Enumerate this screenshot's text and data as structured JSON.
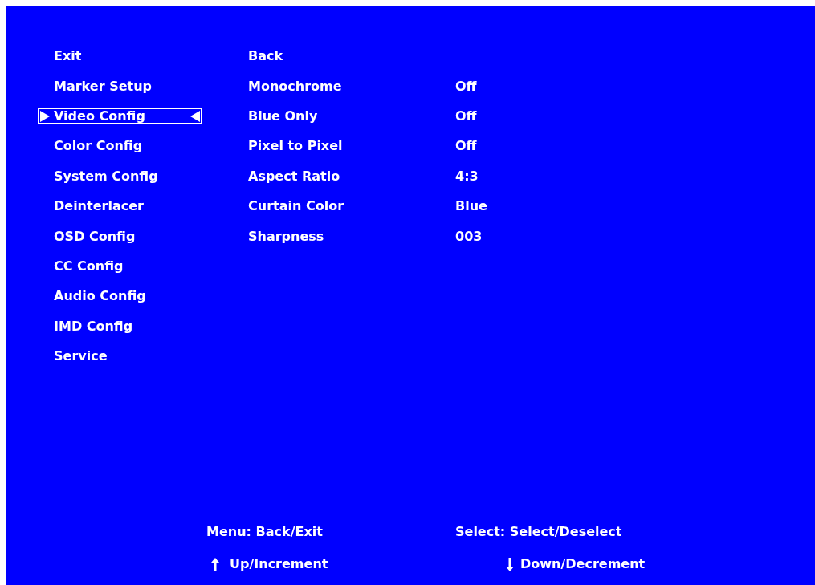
{
  "menu": [
    {
      "label": "Exit",
      "selected": false
    },
    {
      "label": "Marker Setup",
      "selected": false
    },
    {
      "label": "Video Config",
      "selected": true
    },
    {
      "label": "Color Config",
      "selected": false
    },
    {
      "label": "System Config",
      "selected": false
    },
    {
      "label": "Deinterlacer",
      "selected": false
    },
    {
      "label": "OSD Config",
      "selected": false
    },
    {
      "label": "CC Config",
      "selected": false
    },
    {
      "label": "Audio Config",
      "selected": false
    },
    {
      "label": "IMD Config",
      "selected": false
    },
    {
      "label": "Service",
      "selected": false
    }
  ],
  "settings": [
    {
      "label": "Back"
    },
    {
      "label": "Monochrome",
      "value": "Off"
    },
    {
      "label": "Blue Only",
      "value": "Off"
    },
    {
      "label": "Pixel to Pixel",
      "value": "Off"
    },
    {
      "label": "Aspect Ratio",
      "value": "4:3"
    },
    {
      "label": "Curtain Color",
      "value": "Blue"
    },
    {
      "label": "Sharpness",
      "value": "003"
    }
  ],
  "hints": {
    "menu": "Menu: Back/Exit",
    "select": "Select: Select/Deselect",
    "up": "Up/Increment",
    "down": "Down/Decrement"
  }
}
